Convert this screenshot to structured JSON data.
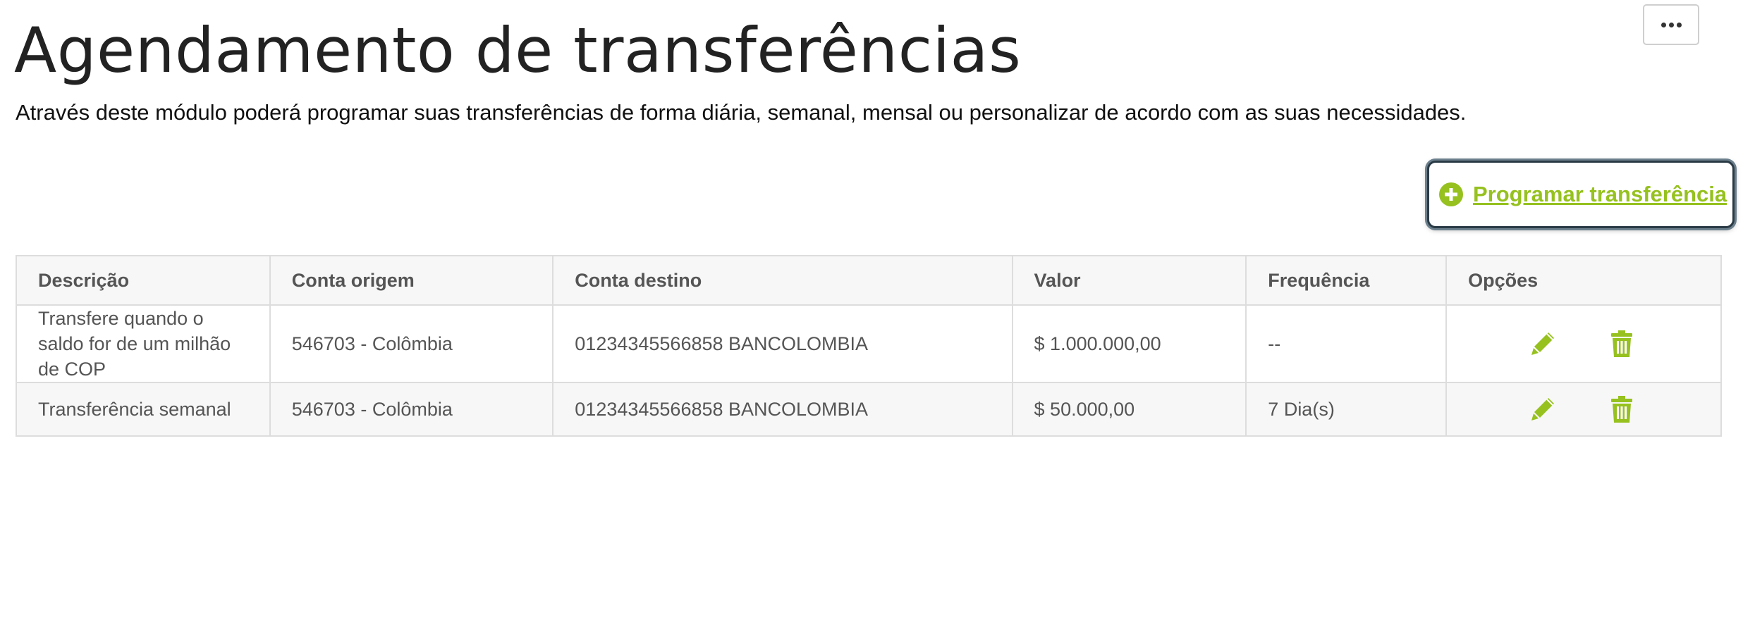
{
  "header": {
    "title": "Agendamento de transferências",
    "description": "Através deste módulo poderá programar suas transferências de forma diária, semanal, mensal ou personalizar de acordo com as suas necessidades.",
    "more_button_icon": "more-horizontal-icon"
  },
  "actions": {
    "schedule_label": "Programar transferência",
    "schedule_icon": "plus-circle-icon"
  },
  "colors": {
    "accent": "#96c11f",
    "title": "#222222",
    "table_border": "#dddddd",
    "focus_ring": "#2a3a45"
  },
  "table": {
    "headers": [
      "Descrição",
      "Conta origem",
      "Conta destino",
      "Valor",
      "Frequência",
      "Opções"
    ],
    "rows": [
      {
        "descricao": "Transfere quando o saldo for de um milhão de COP",
        "conta_origem": "546703 - Colômbia",
        "conta_destino": "01234345566858 BANCOLOMBIA",
        "valor": "$ 1.000.000,00",
        "frequencia": "--"
      },
      {
        "descricao": "Transferência semanal",
        "conta_origem": "546703 - Colômbia",
        "conta_destino": "01234345566858 BANCOLOMBIA",
        "valor": "$ 50.000,00",
        "frequencia": "7 Dia(s)"
      }
    ],
    "option_icons": [
      "pencil-icon",
      "trash-icon"
    ]
  }
}
